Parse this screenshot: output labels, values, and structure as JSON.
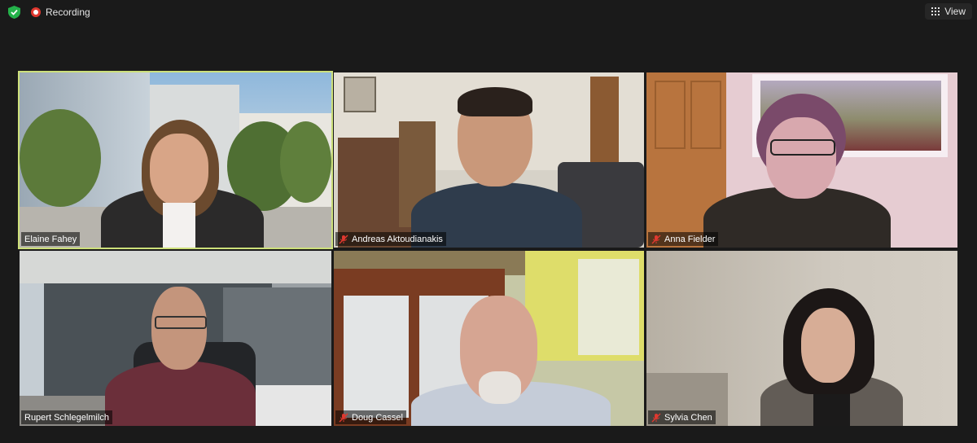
{
  "topbar": {
    "recording_label": "Recording",
    "view_label": "View",
    "shield_icon": "shield-check-icon",
    "view_icon": "grid-icon"
  },
  "colors": {
    "background": "#1a1a1a",
    "active_speaker_border": "#cde07a",
    "recording_red": "#e0382f",
    "muted_red": "#e0382f"
  },
  "participants": [
    {
      "name": "Elaine Fahey",
      "muted": false,
      "active": true
    },
    {
      "name": "Andreas Aktoudianakis",
      "muted": true,
      "active": false
    },
    {
      "name": "Anna Fielder",
      "muted": true,
      "active": false
    },
    {
      "name": "Rupert Schlegelmilch",
      "muted": false,
      "active": false
    },
    {
      "name": "Doug Cassel",
      "muted": true,
      "active": false
    },
    {
      "name": "Sylvia Chen",
      "muted": true,
      "active": false
    }
  ]
}
